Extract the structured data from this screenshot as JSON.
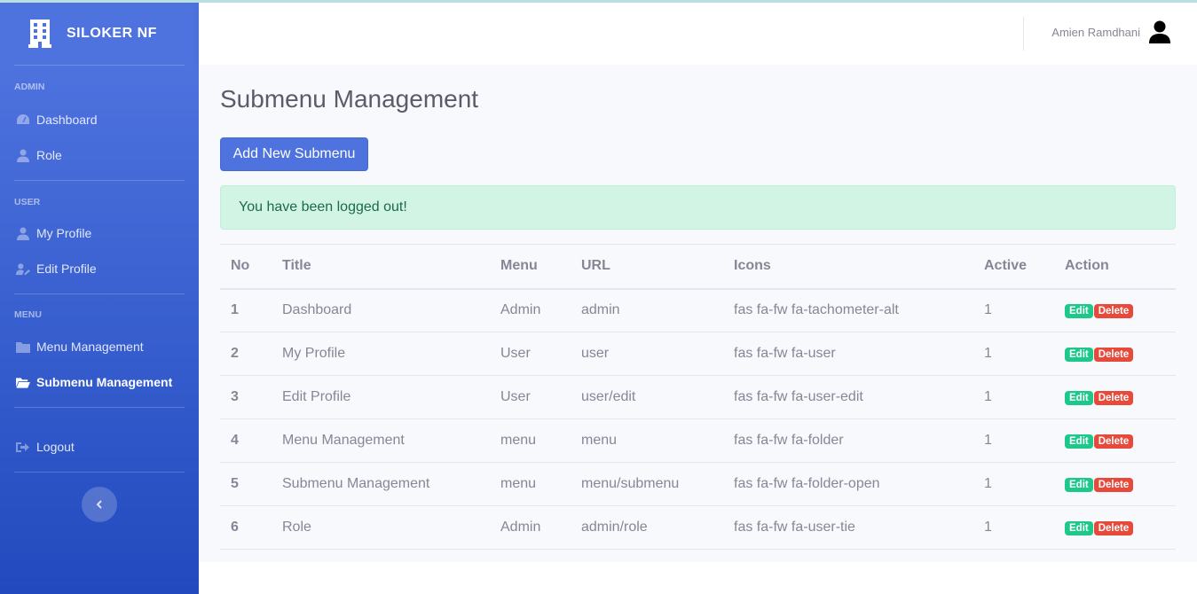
{
  "brand": {
    "name": "SILOKER NF",
    "icon": "building-icon"
  },
  "sidebar": {
    "sections": [
      {
        "heading": "ADMIN",
        "items": [
          {
            "label": "Dashboard",
            "icon": "tachometer-icon"
          },
          {
            "label": "Role",
            "icon": "user-tie-icon"
          }
        ]
      },
      {
        "heading": "USER",
        "items": [
          {
            "label": "My Profile",
            "icon": "user-icon"
          },
          {
            "label": "Edit Profile",
            "icon": "user-edit-icon"
          }
        ]
      },
      {
        "heading": "MENU",
        "items": [
          {
            "label": "Menu Management",
            "icon": "folder-icon"
          },
          {
            "label": "Submenu Management",
            "icon": "folder-open-icon",
            "active": true
          }
        ]
      }
    ],
    "logout": {
      "label": "Logout",
      "icon": "sign-out-icon"
    }
  },
  "topbar": {
    "user_name": "Amien Ramdhani",
    "avatar_icon": "user-avatar-icon"
  },
  "main": {
    "title": "Submenu Management",
    "add_button": "Add New Submenu",
    "alert": "You have been logged out!",
    "table": {
      "headers": [
        "No",
        "Title",
        "Menu",
        "URL",
        "Icons",
        "Active",
        "Action"
      ],
      "rows": [
        [
          "1",
          "Dashboard",
          "Admin",
          "admin",
          "fas fa-fw fa-tachometer-alt",
          "1"
        ],
        [
          "2",
          "My Profile",
          "User",
          "user",
          "fas fa-fw fa-user",
          "1"
        ],
        [
          "3",
          "Edit Profile",
          "User",
          "user/edit",
          "fas fa-fw fa-user-edit",
          "1"
        ],
        [
          "4",
          "Menu Management",
          "menu",
          "menu",
          "fas fa-fw fa-folder",
          "1"
        ],
        [
          "5",
          "Submenu Management",
          "menu",
          "menu/submenu",
          "fas fa-fw fa-folder-open",
          "1"
        ],
        [
          "6",
          "Role",
          "Admin",
          "admin/role",
          "fas fa-fw fa-user-tie",
          "1"
        ]
      ],
      "actions": {
        "edit": "Edit",
        "delete": "Delete"
      }
    }
  },
  "colors": {
    "primary": "#4e73df",
    "success": "#1cc88a",
    "danger": "#e74a3b"
  }
}
